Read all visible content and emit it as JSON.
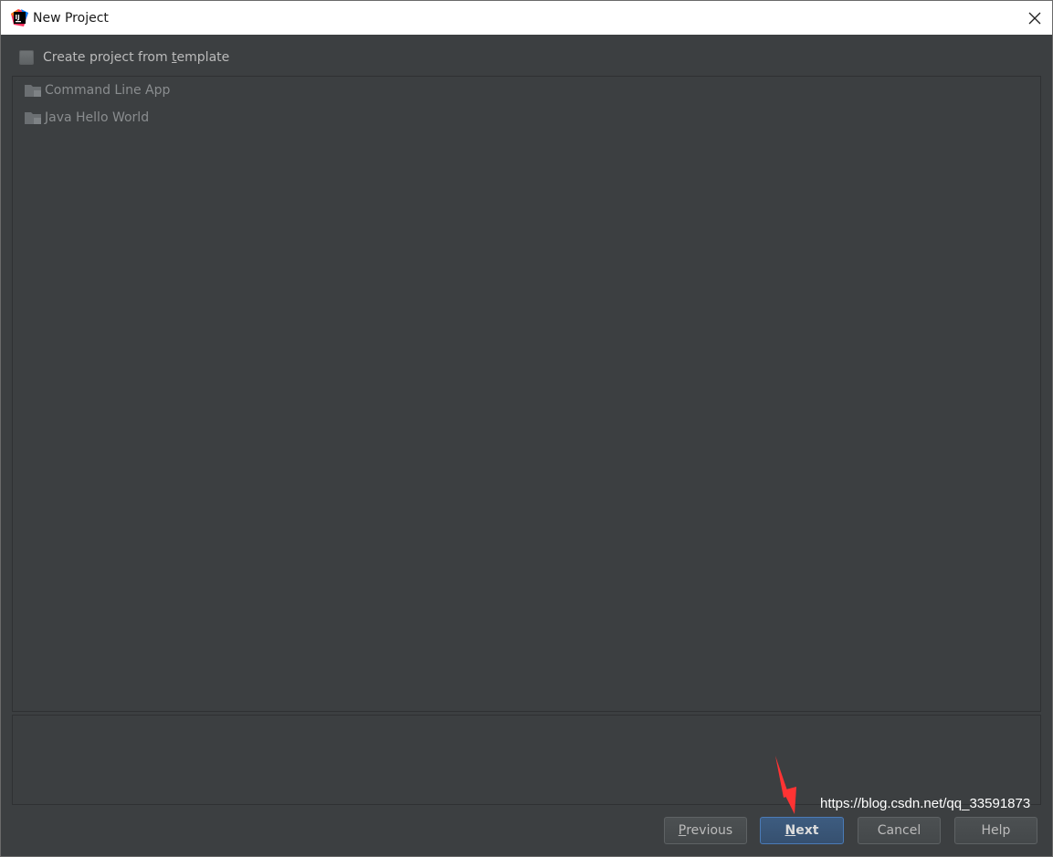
{
  "window": {
    "title": "New Project"
  },
  "create_from_template": {
    "label_before": "Create project from ",
    "label_underlined": "t",
    "label_after": "emplate",
    "checked": false
  },
  "templates": [
    {
      "label": "Command Line App",
      "icon": "folder-icon"
    },
    {
      "label": "Java Hello World",
      "icon": "folder-icon"
    }
  ],
  "buttons": {
    "previous": {
      "mnemonic": "P",
      "rest": "revious"
    },
    "next": {
      "mnemonic": "N",
      "rest": "ext"
    },
    "cancel": {
      "label": "Cancel"
    },
    "help": {
      "label": "Help"
    }
  },
  "watermark": "https://blog.csdn.net/qq_33591873",
  "colors": {
    "background": "#3c3f41",
    "titlebar": "#ffffff",
    "accent_button": "#3d5c80",
    "annotation_arrow": "#ff3333"
  }
}
